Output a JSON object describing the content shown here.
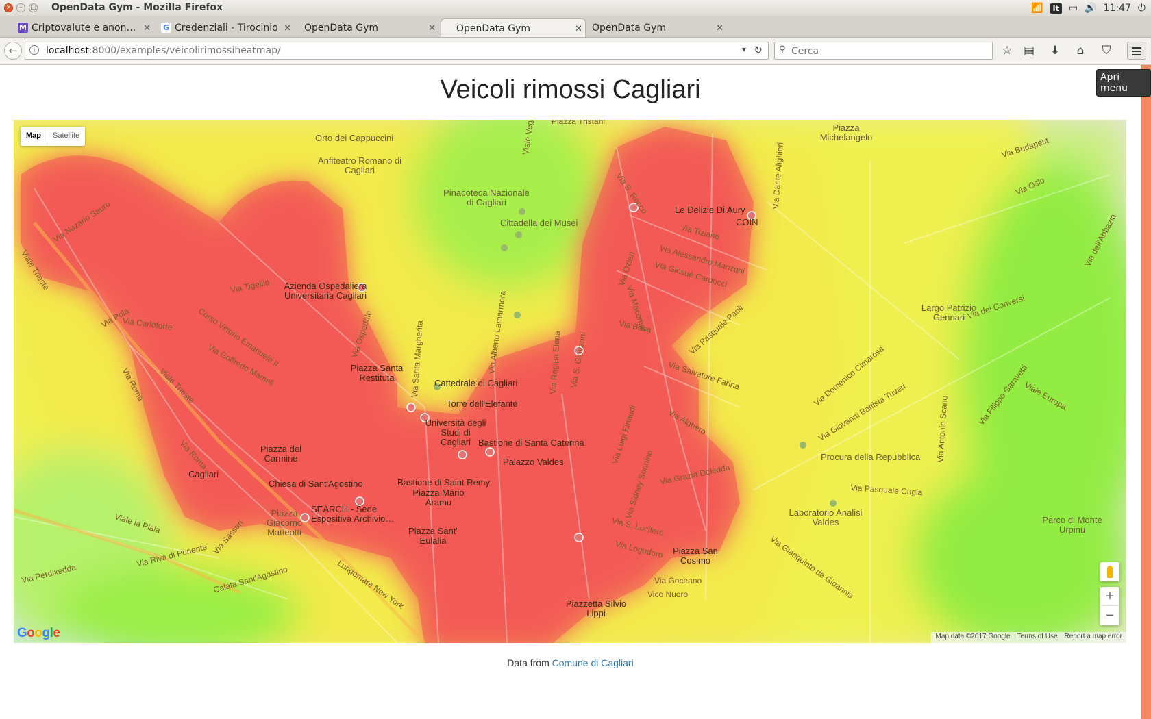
{
  "window": {
    "title": "OpenData Gym - Mozilla Firefox"
  },
  "system_tray": {
    "keyboard_layout": "It",
    "time": "11:47"
  },
  "tabs": [
    {
      "label": "Criptovalute e anon…",
      "icon_color": "#6c4dbf",
      "icon": "M"
    },
    {
      "label": "Credenziali - Tirocinio",
      "icon_color": "#4285f4",
      "icon": "G"
    },
    {
      "label": "OpenData Gym"
    },
    {
      "label": "OpenData Gym",
      "active": true
    },
    {
      "label": "OpenData Gym"
    }
  ],
  "navbar": {
    "url_host": "localhost",
    "url_path": ":8000/examples/veicolirimossiheatmap/",
    "search_placeholder": "Cerca",
    "menu_tooltip": "Apri menu"
  },
  "page": {
    "title": "Veicoli rimossi Cagliari",
    "footer_prefix": "Data from",
    "footer_link": "Comune di Cagliari"
  },
  "map": {
    "type_control": {
      "map": "Map",
      "satellite": "Satellite"
    },
    "zoom_in": "+",
    "zoom_out": "−",
    "logo": [
      "G",
      "o",
      "o",
      "g",
      "l",
      "e"
    ],
    "attribution": {
      "data": "Map data ©2017 Google",
      "terms": "Terms of Use",
      "report": "Report a map error"
    },
    "labels": {
      "orto": "Orto dei Cappuccini",
      "anfiteatro": "Anfiteatro Romano di Cagliari",
      "pinacoteca": "Pinacoteca Nazionale di Cagliari",
      "cittadella": "Cittadella dei Musei",
      "azienda": "Azienda Ospedaliera Universitaria Cagliari",
      "santa_restituta": "Piazza Santa Restituta",
      "cattedrale": "Cattedrale di Cagliari",
      "torre": "Torre dell'Elefante",
      "universita": "Università degli Studi di Cagliari",
      "bastione_caterina": "Bastione di Santa Caterina",
      "palazzo_valdes": "Palazzo Valdes",
      "bastione_remy": "Bastione di Saint Remy",
      "piazza_mario": "Piazza Mario Aramu",
      "piazza_eulalia": "Piazza Sant' Eulalia",
      "piazza_carmine": "Piazza del Carmine",
      "cagliari_station": "Cagliari",
      "chiesa_agostino": "Chiesa di Sant'Agostino",
      "search_sede": "SEARCH - Sede Espositiva Archivio…",
      "piazza_matteotti": "Piazza Giacomo Matteotti",
      "le_delizie": "Le Delizie Di Aury",
      "coin": "COIN",
      "piazza_michelangelo": "Piazza Michelangelo",
      "largo_gennari": "Largo Patrizio Gennari",
      "procura": "Procura della Repubblica",
      "laboratorio": "Laboratorio Analisi Valdes",
      "piazza_cosimo": "Piazza San Cosimo",
      "piazzetta_lippi": "Piazzetta Silvio Lippi",
      "parco_urpinu": "Parco di Monte Urpinu",
      "via_trieste": "Viale Trieste",
      "via_roma": "Via Roma",
      "via_roma2": "Via Roma",
      "viale_trieste2": "Viale Trieste",
      "viale_la_plaia": "Viale la Plaia",
      "via_riva_ponente": "Via Riva di Ponente",
      "via_perdixedda": "Via Perdixedda",
      "lungomare": "Lungomare New York",
      "via_nazario_sauro": "Via Nazario Sauro",
      "corso_vittorio": "Corso Vittorio Emanuele II",
      "via_goffredo": "Via Goffredo Mameli",
      "via_tigellio": "Via Tigellio",
      "via_pola": "Via Pola",
      "via_carloforte": "Via Carloforte",
      "via_sassari": "Via Sassari",
      "calata": "Calata Sant'Agostino",
      "via_tiziano": "Via Tiziano",
      "via_manzoni": "Via Alessandro Manzoni",
      "via_carducci": "Via Giosuè Carducci",
      "via_pasquale_paoli": "Via Pasquale Paoli",
      "via_bosa": "Via Bosa",
      "via_salvatore_farina": "Via Salvatore Farina",
      "via_alghero": "Via Alghero",
      "via_grazia": "Via Grazia Deledda",
      "via_lucifero": "Via S. Lucifero",
      "via_logudoro": "Via Logudoro",
      "via_goceano": "Via Goceano",
      "vico_nuoro": "Vico Nuoro",
      "via_dei_conversi": "Via dei Conversi",
      "via_cugia": "Via Pasquale Cugia",
      "viale_europa": "Viale Europa",
      "via_budapest": "Via Budapest",
      "via_oslo": "Via Oslo",
      "viale_vega": "Viale Vega",
      "piazza_tristani": "Piazza Tristani",
      "via_dante": "Via Dante Alighieri",
      "via_sonnino": "Via Sidney Sonnino",
      "via_dettori": "Via S. Giovanni",
      "via_einaudi": "Via Luigi Einaudi",
      "via_ospedale": "Via Ospedale",
      "via_santa_margherita": "Via Santa Margherita",
      "via_regina_elena": "Via Regina Elena",
      "via_ozieri": "Via Ozieri",
      "via_macomer": "Via Macomer",
      "via_rocco": "Via S. Rocco",
      "via_alberto": "Via Alberto Lamarmora",
      "via_cimarosa": "Via Domenico Cimarosa",
      "via_tuveri": "Via Giovanni Battista Tuveri",
      "via_scano": "Via Antonio Scano",
      "via_cannas": "Via Gianquinto de Gioannis",
      "via_garavetti": "Via Filippo Garavetti",
      "via_abbazia": "Via dell'Abbazia"
    }
  },
  "heatmap_colors": {
    "hot": "#f25353",
    "warm": "#f5ee4a",
    "cool": "#9aee45"
  }
}
